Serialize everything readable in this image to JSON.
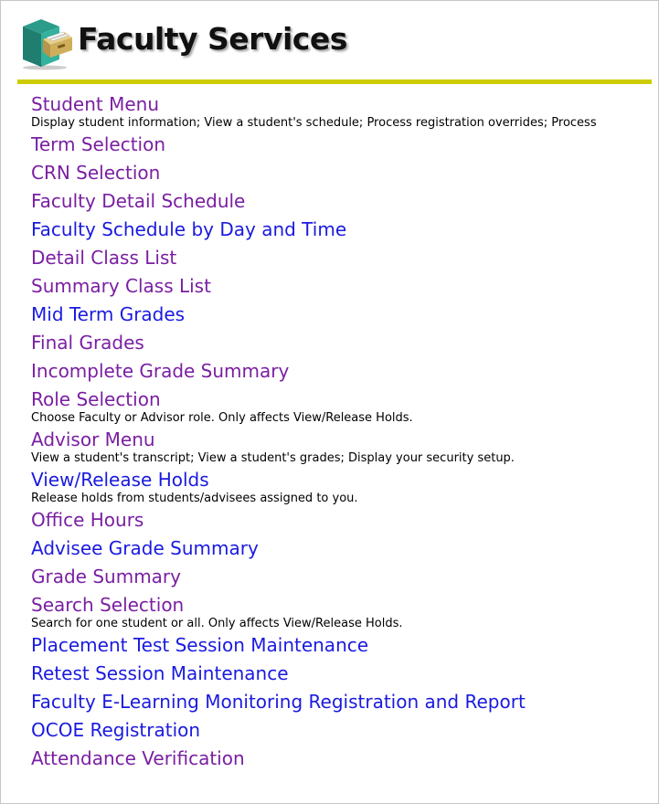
{
  "header": {
    "title": "Faculty Services",
    "icon": "file-cabinet-icon"
  },
  "colors": {
    "rule": "#cccc00",
    "visited_link": "#7a1fa2",
    "unvisited_link": "#1a1ae0"
  },
  "menu": [
    {
      "label": "Student Menu",
      "visited": true,
      "description": "Display student information; View a student's schedule; Process registration overrides; Process"
    },
    {
      "label": "Term Selection",
      "visited": true,
      "description": ""
    },
    {
      "label": "CRN Selection",
      "visited": true,
      "description": ""
    },
    {
      "label": "Faculty Detail Schedule",
      "visited": true,
      "description": ""
    },
    {
      "label": "Faculty Schedule by Day and Time",
      "visited": false,
      "description": ""
    },
    {
      "label": "Detail Class List",
      "visited": true,
      "description": ""
    },
    {
      "label": "Summary Class List",
      "visited": true,
      "description": ""
    },
    {
      "label": "Mid Term Grades",
      "visited": false,
      "description": ""
    },
    {
      "label": "Final Grades",
      "visited": true,
      "description": ""
    },
    {
      "label": "Incomplete Grade Summary",
      "visited": true,
      "description": ""
    },
    {
      "label": "Role Selection",
      "visited": true,
      "description": "Choose Faculty or Advisor role. Only affects View/Release Holds."
    },
    {
      "label": "Advisor Menu",
      "visited": true,
      "description": "View a student's transcript; View a student's grades; Display your security setup."
    },
    {
      "label": "View/Release Holds",
      "visited": false,
      "description": "Release holds from students/advisees assigned to you."
    },
    {
      "label": "Office Hours",
      "visited": true,
      "description": ""
    },
    {
      "label": "Advisee Grade Summary",
      "visited": false,
      "description": ""
    },
    {
      "label": "Grade Summary",
      "visited": true,
      "description": ""
    },
    {
      "label": "Search Selection",
      "visited": true,
      "description": "Search for one student or all. Only affects View/Release Holds."
    },
    {
      "label": "Placement Test Session Maintenance",
      "visited": false,
      "description": ""
    },
    {
      "label": "Retest Session Maintenance",
      "visited": false,
      "description": ""
    },
    {
      "label": "Faculty E-Learning Monitoring Registration and Report",
      "visited": false,
      "description": ""
    },
    {
      "label": "OCOE Registration",
      "visited": false,
      "description": ""
    },
    {
      "label": "Attendance Verification",
      "visited": true,
      "description": ""
    }
  ]
}
